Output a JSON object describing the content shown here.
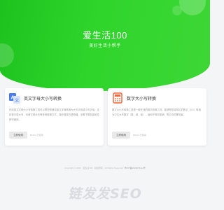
{
  "hero": {
    "title": "爱生活100",
    "subtitle": "美好生活小帮手",
    "color": "#2fd52b"
  },
  "tools": [
    {
      "icon": "translate-letter-icon",
      "title": "英文字母大小写转换",
      "description": "在线英文字母大小写转换工具可以帮您快速将英文字母转换为大写字母或小写字母，支持首字母大写、句首字母大写等多种转换方式，操作简单方便快捷，无需下载安装软件即可使用。",
      "button": "立即使用",
      "count": "8425人已使用"
    },
    {
      "icon": "calculator-icon",
      "title": "数字大小写转换",
      "description": "数字大小写转换工具是一款在线的数字转换工具，能够帮您将阿拉伯数字（0-9）转换为中文大写数字（壹、贰、叁），适用于财务报销、签订合同等场景。",
      "button": "立即使用",
      "count": "8204人已使用"
    }
  ],
  "footer": {
    "copyright": "Copyright © 2021 · 爱生活100 · 版权所有 · All Rights Reserved",
    "icp": "粤ICP备2021074xxx号"
  },
  "watermark": "链发发SEO"
}
